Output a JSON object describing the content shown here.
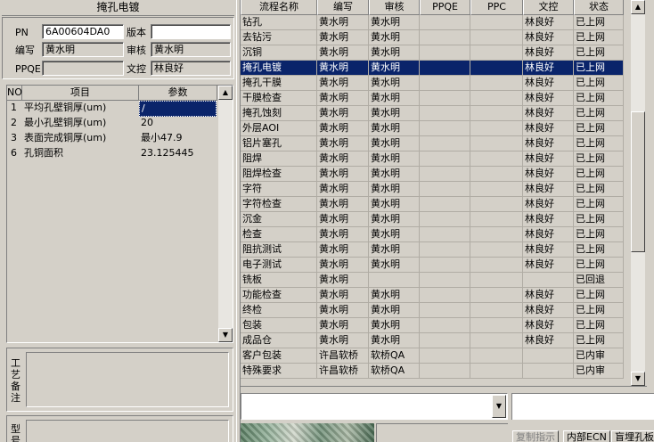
{
  "section_title": "掩孔电镀",
  "info": {
    "pn_label": "PN",
    "pn_value": "6A00604DA0",
    "version_label": "版本",
    "version_value": "",
    "author_label": "编写",
    "author_value": "黄水明",
    "reviewer_label": "审核",
    "reviewer_value": "黄水明",
    "ppqe_label": "PPQE",
    "ppqe_value": "",
    "doc_control_label": "文控",
    "doc_control_value": "林良好"
  },
  "param_grid": {
    "headers": {
      "no": "NO",
      "item": "项目",
      "param": "参数"
    },
    "rows": [
      {
        "no": "1",
        "item": "平均孔壁铜厚(um)",
        "param": "/"
      },
      {
        "no": "2",
        "item": "最小孔壁铜厚(um)",
        "param": "20"
      },
      {
        "no": "3",
        "item": "表面完成铜厚(um)",
        "param": "最小47.9"
      },
      {
        "no": "6",
        "item": "孔铜面积",
        "param": "23.125445"
      }
    ]
  },
  "remarks_label": "工艺备注",
  "model_label": "型号",
  "flow_grid": {
    "headers": {
      "process": "流程名称",
      "author": "编写",
      "reviewer": "审核",
      "ppqe": "PPQE",
      "ppc": "PPC",
      "doc_control": "文控",
      "status": "状态"
    },
    "selected_index": 3,
    "rows": [
      {
        "process": "钻孔",
        "author": "黄水明",
        "reviewer": "黄水明",
        "ppqe": "",
        "ppc": "",
        "doc_control": "林良好",
        "status": "已上网"
      },
      {
        "process": "去钻污",
        "author": "黄水明",
        "reviewer": "黄水明",
        "ppqe": "",
        "ppc": "",
        "doc_control": "林良好",
        "status": "已上网"
      },
      {
        "process": "沉铜",
        "author": "黄水明",
        "reviewer": "黄水明",
        "ppqe": "",
        "ppc": "",
        "doc_control": "林良好",
        "status": "已上网"
      },
      {
        "process": "掩孔电镀",
        "author": "黄水明",
        "reviewer": "黄水明",
        "ppqe": "",
        "ppc": "",
        "doc_control": "林良好",
        "status": "已上网"
      },
      {
        "process": "掩孔干膜",
        "author": "黄水明",
        "reviewer": "黄水明",
        "ppqe": "",
        "ppc": "",
        "doc_control": "林良好",
        "status": "已上网"
      },
      {
        "process": "干膜检查",
        "author": "黄水明",
        "reviewer": "黄水明",
        "ppqe": "",
        "ppc": "",
        "doc_control": "林良好",
        "status": "已上网"
      },
      {
        "process": "掩孔蚀刻",
        "author": "黄水明",
        "reviewer": "黄水明",
        "ppqe": "",
        "ppc": "",
        "doc_control": "林良好",
        "status": "已上网"
      },
      {
        "process": "外层AOI",
        "author": "黄水明",
        "reviewer": "黄水明",
        "ppqe": "",
        "ppc": "",
        "doc_control": "林良好",
        "status": "已上网"
      },
      {
        "process": "铝片塞孔",
        "author": "黄水明",
        "reviewer": "黄水明",
        "ppqe": "",
        "ppc": "",
        "doc_control": "林良好",
        "status": "已上网"
      },
      {
        "process": "阻焊",
        "author": "黄水明",
        "reviewer": "黄水明",
        "ppqe": "",
        "ppc": "",
        "doc_control": "林良好",
        "status": "已上网"
      },
      {
        "process": "阻焊检查",
        "author": "黄水明",
        "reviewer": "黄水明",
        "ppqe": "",
        "ppc": "",
        "doc_control": "林良好",
        "status": "已上网"
      },
      {
        "process": "字符",
        "author": "黄水明",
        "reviewer": "黄水明",
        "ppqe": "",
        "ppc": "",
        "doc_control": "林良好",
        "status": "已上网"
      },
      {
        "process": "字符检查",
        "author": "黄水明",
        "reviewer": "黄水明",
        "ppqe": "",
        "ppc": "",
        "doc_control": "林良好",
        "status": "已上网"
      },
      {
        "process": "沉金",
        "author": "黄水明",
        "reviewer": "黄水明",
        "ppqe": "",
        "ppc": "",
        "doc_control": "林良好",
        "status": "已上网"
      },
      {
        "process": "检查",
        "author": "黄水明",
        "reviewer": "黄水明",
        "ppqe": "",
        "ppc": "",
        "doc_control": "林良好",
        "status": "已上网"
      },
      {
        "process": "阻抗测试",
        "author": "黄水明",
        "reviewer": "黄水明",
        "ppqe": "",
        "ppc": "",
        "doc_control": "林良好",
        "status": "已上网"
      },
      {
        "process": "电子测试",
        "author": "黄水明",
        "reviewer": "黄水明",
        "ppqe": "",
        "ppc": "",
        "doc_control": "林良好",
        "status": "已上网"
      },
      {
        "process": "铣板",
        "author": "黄水明",
        "reviewer": "",
        "ppqe": "",
        "ppc": "",
        "doc_control": "",
        "status": "已回退"
      },
      {
        "process": "功能检查",
        "author": "黄水明",
        "reviewer": "黄水明",
        "ppqe": "",
        "ppc": "",
        "doc_control": "林良好",
        "status": "已上网"
      },
      {
        "process": "终检",
        "author": "黄水明",
        "reviewer": "黄水明",
        "ppqe": "",
        "ppc": "",
        "doc_control": "林良好",
        "status": "已上网"
      },
      {
        "process": "包装",
        "author": "黄水明",
        "reviewer": "黄水明",
        "ppqe": "",
        "ppc": "",
        "doc_control": "林良好",
        "status": "已上网"
      },
      {
        "process": "成品仓",
        "author": "黄水明",
        "reviewer": "黄水明",
        "ppqe": "",
        "ppc": "",
        "doc_control": "林良好",
        "status": "已上网"
      },
      {
        "process": "客户包装",
        "author": "许昌软桥",
        "reviewer": "软桥QA",
        "ppqe": "",
        "ppc": "",
        "doc_control": "",
        "status": "已内审"
      },
      {
        "process": "特殊要求",
        "author": "许昌软桥",
        "reviewer": "软桥QA",
        "ppqe": "",
        "ppc": "",
        "doc_control": "",
        "status": "已内审"
      }
    ]
  },
  "bottom_tabs": {
    "copy_instruction": "复制指示",
    "internal_ecn": "内部ECN",
    "buried_hole": "盲埋孔板"
  },
  "icons": {
    "scroll_up": "scroll-up-icon",
    "scroll_down": "scroll-down-icon",
    "combo_dropdown": "chevron-down-icon"
  },
  "colors": {
    "selection": "#0a246a",
    "window_face": "#d4d0c8"
  }
}
